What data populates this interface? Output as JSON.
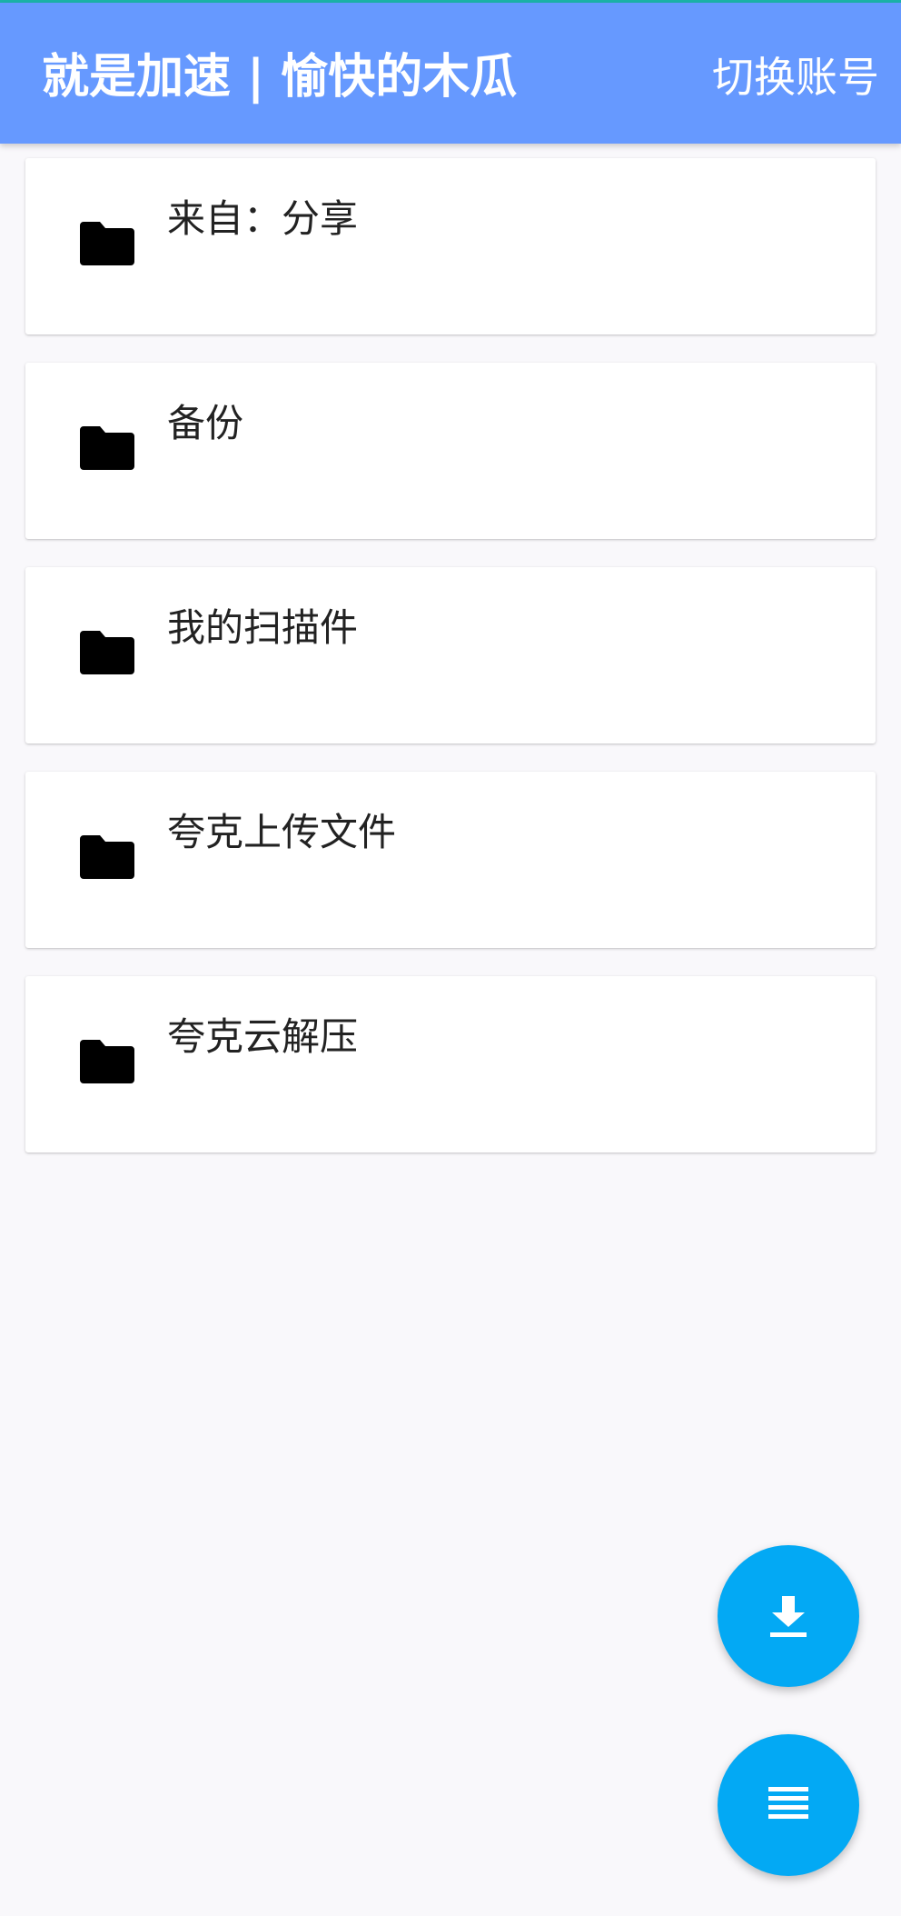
{
  "header": {
    "title": "就是加速 | 愉快的木瓜",
    "switch_account_label": "切换账号"
  },
  "folders": [
    {
      "name": "来自：分享",
      "icon": "folder-icon"
    },
    {
      "name": "备份",
      "icon": "folder-icon"
    },
    {
      "name": "我的扫描件",
      "icon": "folder-icon"
    },
    {
      "name": "夸克上传文件",
      "icon": "folder-icon"
    },
    {
      "name": "夸克云解压",
      "icon": "folder-icon"
    }
  ],
  "fabs": {
    "download_icon": "download-icon",
    "menu_icon": "menu-icon"
  },
  "colors": {
    "app_bar": "#6699ff",
    "fab": "#03a9f4",
    "background": "#f9f8fb"
  }
}
